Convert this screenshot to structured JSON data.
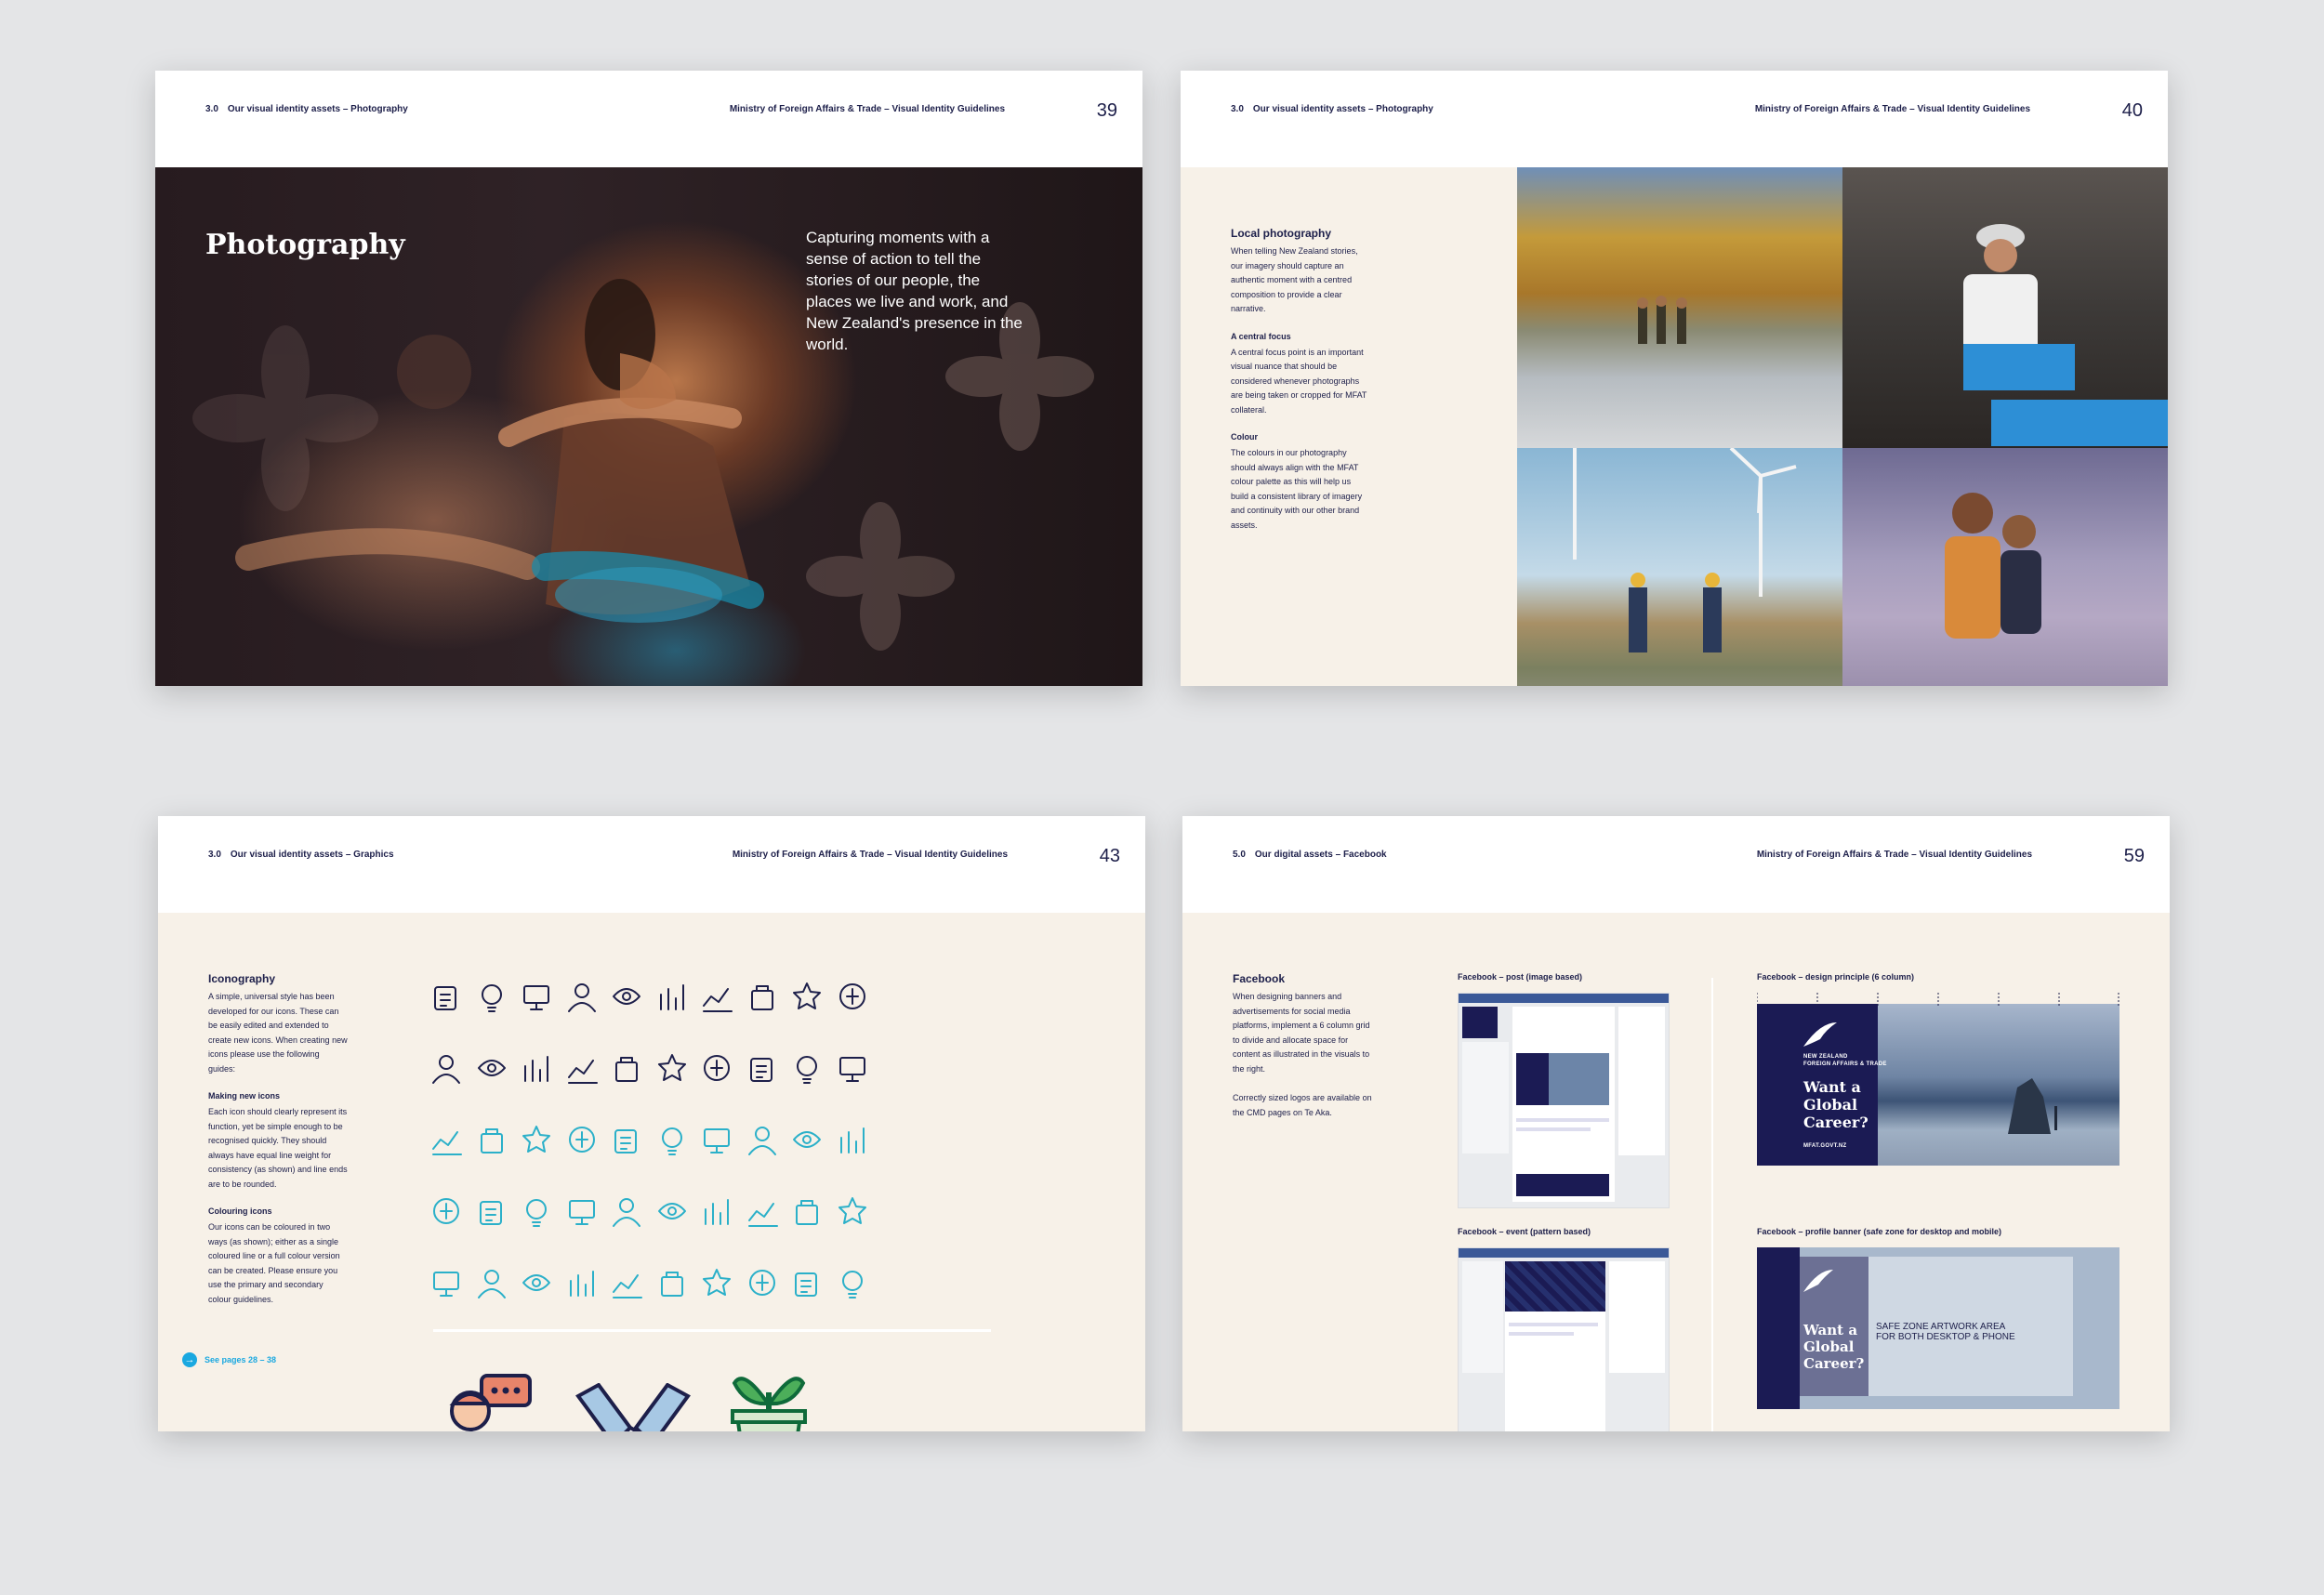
{
  "pages": [
    {
      "section_num": "3.0",
      "section": "Our visual identity assets – Photography",
      "ministry": "Ministry of Foreign Affairs & Trade – Visual Identity Guidelines",
      "page_number": "39",
      "title": "Photography",
      "quote": "Capturing moments with a sense of action to tell the stories of our people, the places we live and work, and New Zealand's presence in the world."
    },
    {
      "section_num": "3.0",
      "section": "Our visual identity assets – Photography",
      "ministry": "Ministry of Foreign Affairs & Trade – Visual Identity Guidelines",
      "page_number": "40",
      "blocks": [
        {
          "heading": "Local photography",
          "text": "When telling New Zealand stories, our imagery should capture an authentic moment with a centred composition to provide a clear narrative."
        },
        {
          "heading": "A central focus",
          "text": "A central focus point is an important visual nuance that should be considered whenever photographs are being taken or cropped for MFAT collateral."
        },
        {
          "heading": "Colour",
          "text": "The colours in our photography should always align with the MFAT colour palette as this will help us build a consistent library of imagery and continuity with our other brand assets."
        }
      ]
    },
    {
      "section_num": "3.0",
      "section": "Our visual identity assets – Graphics",
      "ministry": "Ministry of Foreign Affairs & Trade – Visual Identity Guidelines",
      "page_number": "43",
      "blocks": [
        {
          "heading": "Iconography",
          "text": "A simple, universal style has been developed for our icons. These can be easily edited and extended to create new icons. When creating new icons please use the following guides:"
        },
        {
          "heading": "Making new icons",
          "text": "Each icon should clearly represent its function, yet be simple enough to be recognised quickly. They should always have equal line weight for consistency (as shown) and line ends are to be rounded."
        },
        {
          "heading": "Colouring icons",
          "text": "Our icons can be coloured in two ways (as shown); either as a single coloured line or a full colour version can be created. Please ensure you use the primary and secondary colour guidelines."
        }
      ],
      "link": "See pages 28 – 38"
    },
    {
      "section_num": "5.0",
      "section": "Our digital assets – Facebook",
      "ministry": "Ministry of Foreign Affairs & Trade – Visual Identity Guidelines",
      "page_number": "59",
      "blocks": [
        {
          "heading": "Facebook",
          "text": "When designing banners and advertisements for social media platforms, implement a 6 column grid to divide and allocate space for content as illustrated in the visuals to the right."
        },
        {
          "heading": "",
          "text": "Correctly sized logos are available on the CMD pages on Te Aka."
        }
      ],
      "captions": {
        "post": "Facebook – post (image based)",
        "design": "Facebook – design principle (6 column)",
        "event": "Facebook – event (pattern based)",
        "profile": "Facebook – profile banner (safe zone for desktop and mobile)"
      },
      "banner": {
        "org1": "NEW ZEALAND",
        "org2": "FOREIGN AFFAIRS & TRADE",
        "headline1": "Want a",
        "headline2": "Global",
        "headline3": "Career?",
        "url": "MFAT.GOVT.NZ",
        "safe_zone1": "SAFE ZONE ARTWORK AREA",
        "safe_zone2": "FOR BOTH DESKTOP & PHONE"
      }
    }
  ],
  "colors": {
    "navy": "#1d1f4a",
    "cream": "#f7f1e8",
    "teal_icon": "#2bb0c9",
    "navy_icon": "#1d1f4a",
    "link_blue": "#1aa8e0",
    "banner_navy": "#1b1b54"
  },
  "icons_navy": [
    "hand-percent-icon",
    "document-chart-icon",
    "fish-water-icon",
    "presentation-easel-icon",
    "clipboard-icon",
    "business-person-icon",
    "presentation-chart-icon",
    "money-person-icon",
    "coins-icon",
    "tv-icon",
    "fish-waves-icon",
    "people-network-icon",
    "person-laptop-icon",
    "computer-icon",
    "gear-head-icon",
    "bar-chart-icon",
    "idea-head-icon",
    "house-percent-icon",
    "globe-plane-icon",
    "mountain-flag-icon"
  ],
  "icons_teal": [
    "plant-money-icon",
    "thumbs-up-icon",
    "gear-icon",
    "money-person-icon",
    "search-money-icon",
    "person-list-icon",
    "growth-chart-icon",
    "brain-icon",
    "idea-dollar-icon",
    "money-bag-icon",
    "network-icon",
    "org-chart-icon",
    "lightbulb-icon",
    "group-icon",
    "handshake-icon",
    "factory-icon",
    "hand-money-icon",
    "megaphone-icon",
    "podium-icon",
    "hands-money-icon",
    "innovation-icon",
    "team-money-icon",
    "store-icon",
    "rocket-icon",
    "chess-knight-icon",
    "target-icon",
    "stopwatch-icon",
    "dollar-cycle-icon",
    "building-people-icon",
    "eye-icon"
  ],
  "icons_color": [
    "speaking-person-icon",
    "handshake-icon",
    "plant-money-icon"
  ]
}
